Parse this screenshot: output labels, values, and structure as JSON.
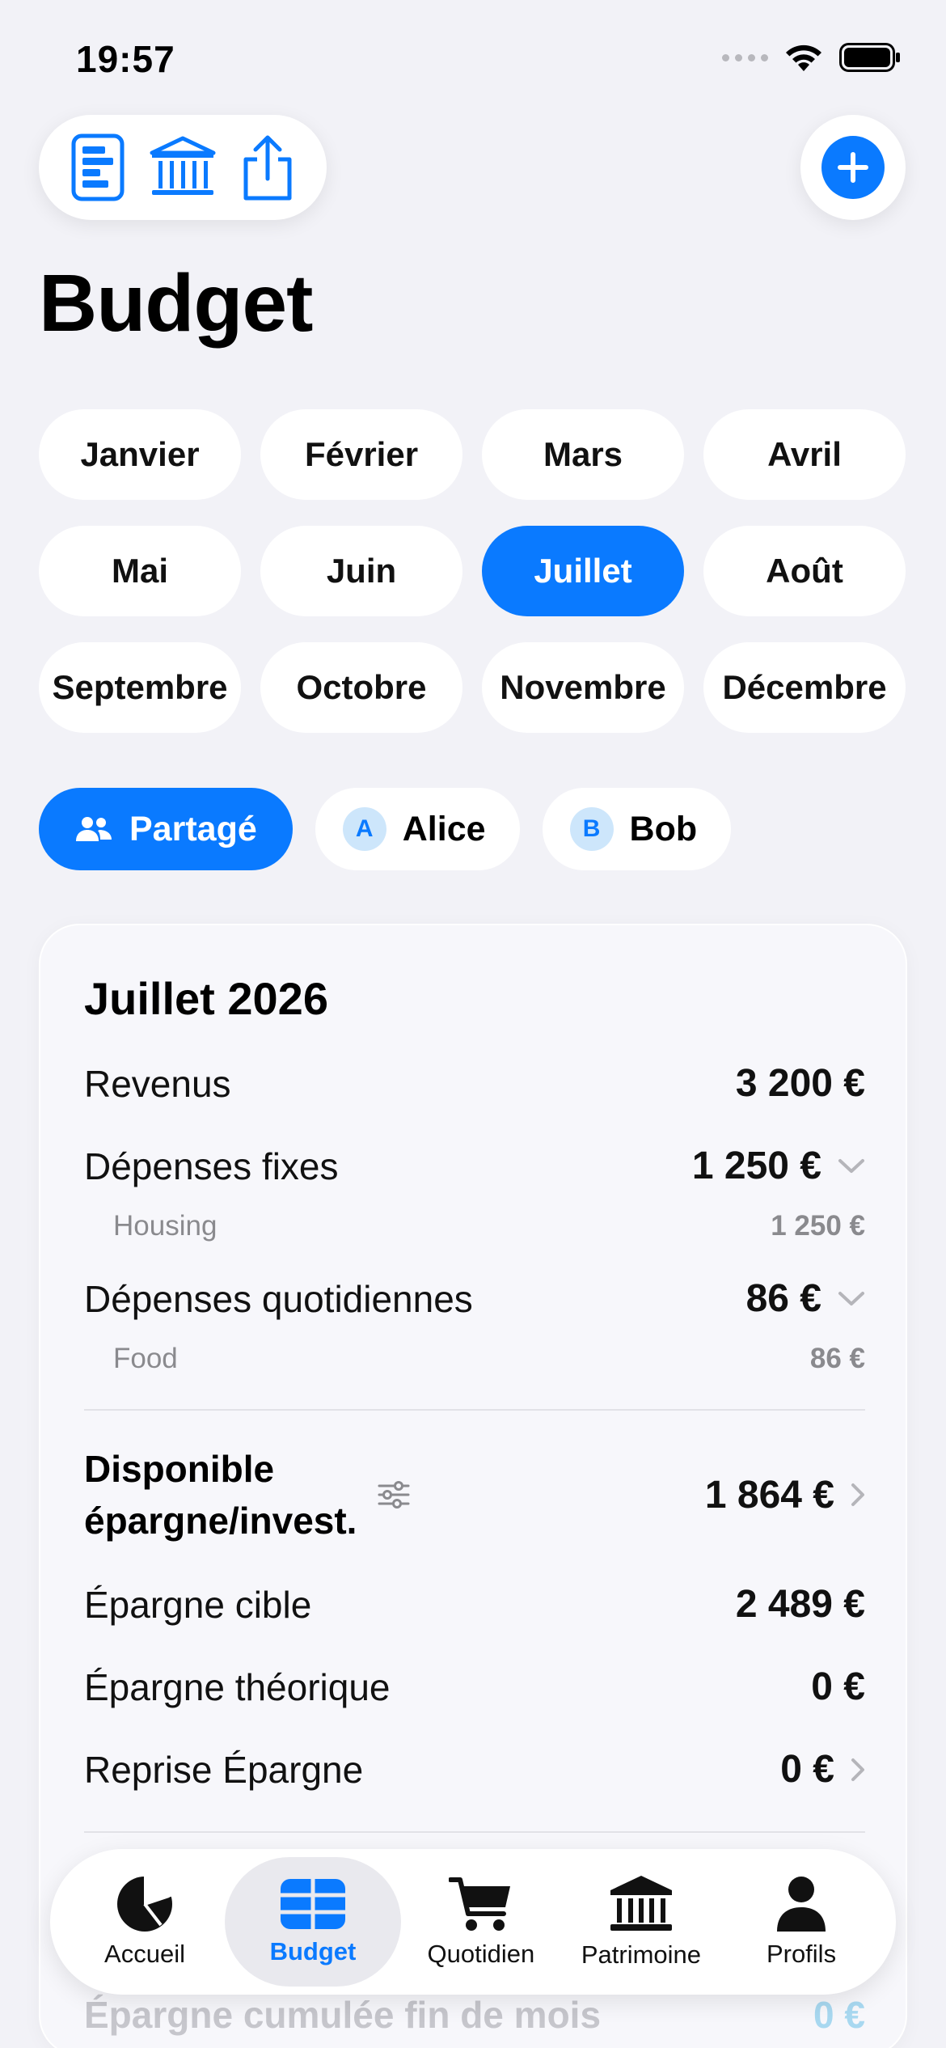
{
  "status_bar": {
    "time": "19:57"
  },
  "page": {
    "title": "Budget"
  },
  "months": [
    "Janvier",
    "Février",
    "Mars",
    "Avril",
    "Mai",
    "Juin",
    "Juillet",
    "Août",
    "Septembre",
    "Octobre",
    "Novembre",
    "Décembre"
  ],
  "selected_month": "Juillet",
  "profiles": {
    "shared": "Partagé",
    "alice": {
      "initial": "A",
      "name": "Alice"
    },
    "bob": {
      "initial": "B",
      "name": "Bob"
    }
  },
  "summary": {
    "title": "Juillet 2026",
    "revenus": {
      "label": "Revenus",
      "value": "3 200 €"
    },
    "fixes": {
      "label": "Dépenses fixes",
      "value": "1 250 €",
      "sub_label": "Housing",
      "sub_value": "1 250 €"
    },
    "quotidiennes": {
      "label": "Dépenses quotidiennes",
      "value": "86 €",
      "sub_label": "Food",
      "sub_value": "86 €"
    },
    "disponible": {
      "label_line1": "Disponible",
      "label_line2": "épargne/invest.",
      "value": "1 864 €"
    },
    "cible": {
      "label": "Épargne cible",
      "value": "2 489 €"
    },
    "theorique": {
      "label": "Épargne théorique",
      "value": "0 €"
    },
    "reprise": {
      "label": "Reprise Épargne",
      "value": "0 €"
    },
    "cumulee": {
      "label": "Épargne cumulée fin de mois",
      "value": "0 €"
    }
  },
  "tabbar": {
    "accueil": "Accueil",
    "budget": "Budget",
    "quotidien": "Quotidien",
    "patrimoine": "Patrimoine",
    "profils": "Profils"
  },
  "colors": {
    "accent": "#0a7aff",
    "background": "#f2f2f7"
  }
}
